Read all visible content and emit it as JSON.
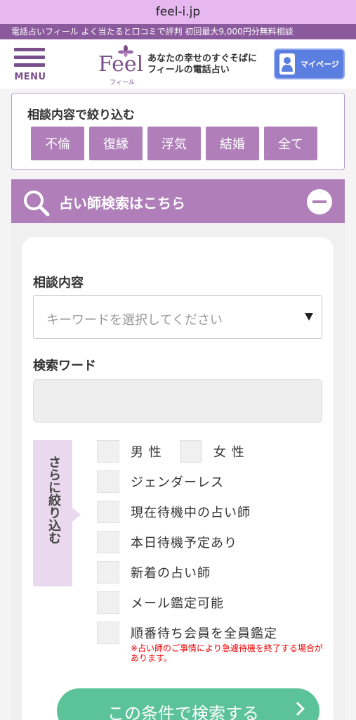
{
  "browser": {
    "url": "feel-i.jp"
  },
  "tagline": "電話占いフィール よく当たると口コミで評判 初回最大9,000円分無料相談",
  "header": {
    "menu_label": "MENU",
    "logo_text": "Feel",
    "logo_sub": "フィール",
    "catch_line1": "あなたの幸せのすぐそばに",
    "catch_line2": "フィールの電話占い",
    "mypage_label": "マイページ"
  },
  "filter": {
    "title": "相談内容で絞り込む",
    "tags": [
      "不倫",
      "復縁",
      "浮気",
      "結婚",
      "全て"
    ]
  },
  "search": {
    "header_title": "占い師検索はこちら",
    "consult_label": "相談内容",
    "select_placeholder": "キーワードを選択してください",
    "keyword_label": "検索ワード",
    "keyword_value": "",
    "narrow_label": "さらに絞り込む",
    "options": {
      "male": "男 性",
      "female": "女 性",
      "genderless": "ジェンダーレス",
      "waiting_now": "現在待機中の占い師",
      "scheduled_today": "本日待機予定あり",
      "newcomer": "新着の占い師",
      "mail_reading": "メール鑑定可能",
      "queue_all": "順番待ち会員を全員鑑定"
    },
    "note": "※占い師のご事情により急遽待機を終了する場合があります。",
    "submit_label": "この条件で検索する"
  },
  "colors": {
    "brand_purple": "#7a4f8c",
    "accent_purple": "#b07fba",
    "mypage_blue": "#5b7fe0",
    "submit_green": "#5cc29a",
    "note_red": "#e00000"
  }
}
